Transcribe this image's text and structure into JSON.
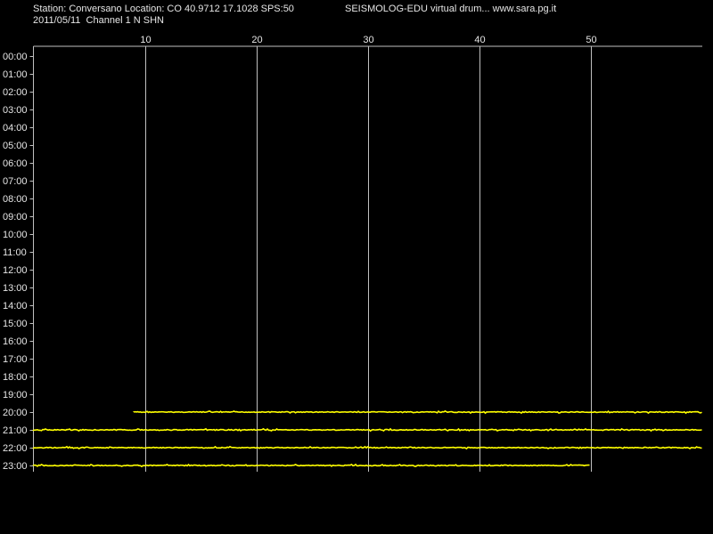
{
  "header": {
    "station_line": "Station: Conversano Location: CO 40.9712 17.1028 SPS:50",
    "date_line": "2011/05/11  Channel 1 N SHN",
    "brand_line": "SEISMOLOG-EDU virtual drum... www.sara.pg.it"
  },
  "colors": {
    "background": "#000000",
    "trace": "#ffff00",
    "grid": "#c0c0c0",
    "text": "#e6e6e6"
  },
  "chart_data": {
    "type": "line",
    "title": "",
    "xlabel": "",
    "ylabel": "",
    "xlim": [
      0,
      60
    ],
    "x_ticks": [
      10,
      20,
      30,
      40,
      50
    ],
    "y_ticks": [
      "00:00",
      "01:00",
      "02:00",
      "03:00",
      "04:00",
      "05:00",
      "06:00",
      "07:00",
      "08:00",
      "09:00",
      "10:00",
      "11:00",
      "12:00",
      "13:00",
      "14:00",
      "15:00",
      "16:00",
      "17:00",
      "18:00",
      "19:00",
      "20:00",
      "21:00",
      "22:00",
      "23:00"
    ],
    "grid": true,
    "series": [
      {
        "hour": "20:00",
        "start_minute": 9,
        "end_minute": 60
      },
      {
        "hour": "21:00",
        "start_minute": 0,
        "end_minute": 60
      },
      {
        "hour": "22:00",
        "start_minute": 0,
        "end_minute": 60
      },
      {
        "hour": "23:00",
        "start_minute": 0,
        "end_minute": 50
      }
    ]
  }
}
